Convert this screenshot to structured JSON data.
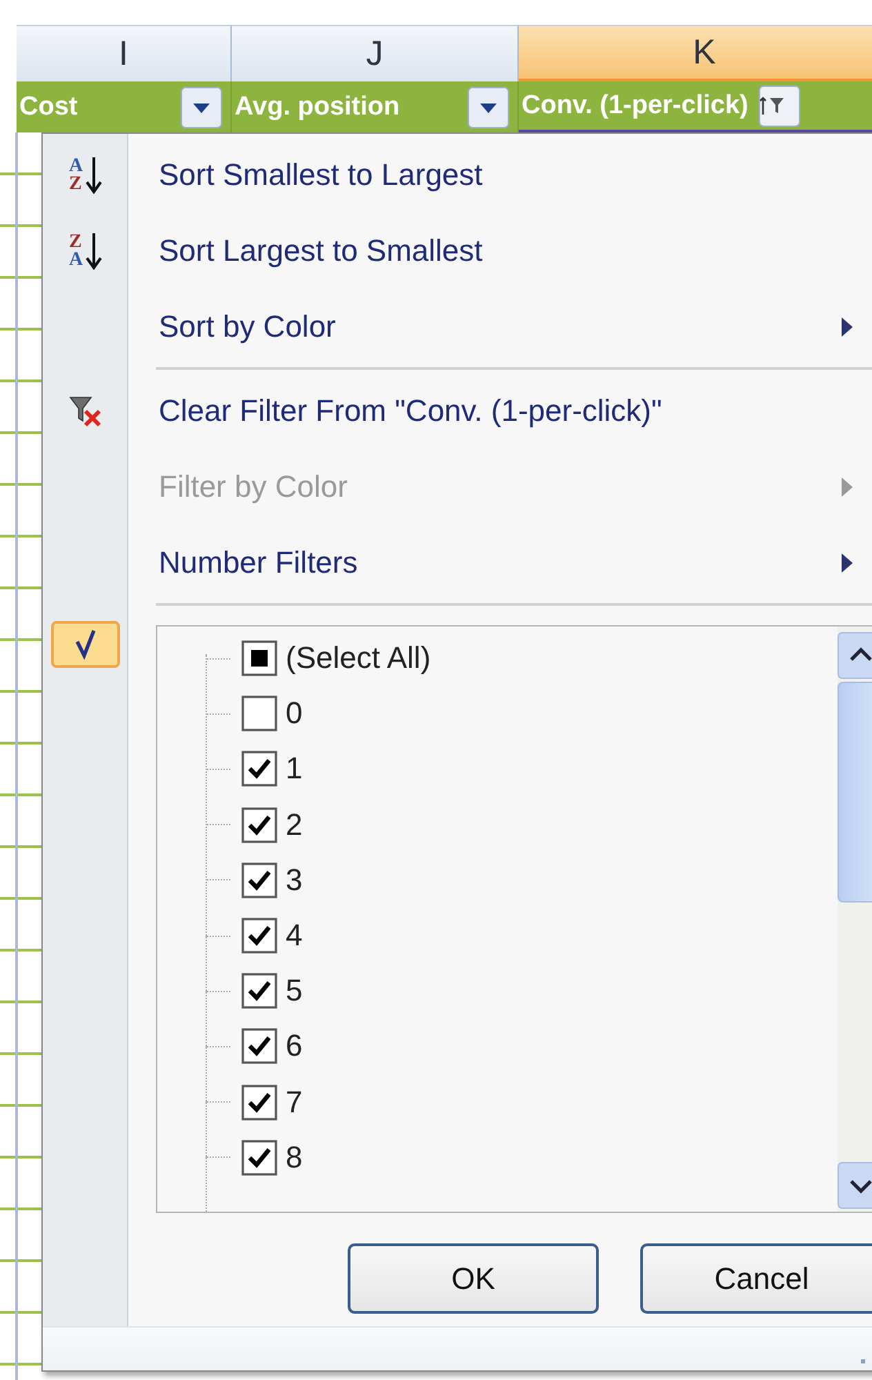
{
  "columns": [
    {
      "letter": "I",
      "selected": false
    },
    {
      "letter": "J",
      "selected": false
    },
    {
      "letter": "K",
      "selected": true
    }
  ],
  "header_cells": [
    {
      "label": "Cost",
      "kind": "dropdown"
    },
    {
      "label": "Avg. position",
      "kind": "dropdown"
    },
    {
      "label": "Conv. (1-per-click)",
      "kind": "filtered"
    }
  ],
  "menu_items": [
    {
      "kind": "sort_ascending",
      "label": "Sort Smallest to Largest",
      "icon_text": [
        "A",
        "Z"
      ],
      "disabled": false,
      "submenu": false
    },
    {
      "kind": "sort_descending",
      "label": "Sort Largest to Smallest",
      "icon_text": [
        "Z",
        "A"
      ],
      "disabled": false,
      "submenu": false
    },
    {
      "kind": "plain",
      "label": "Sort by Color",
      "disabled": false,
      "submenu": true
    },
    {
      "kind": "separator"
    },
    {
      "kind": "clear_filter",
      "label": "Clear Filter From \"Conv. (1-per-click)\"",
      "disabled": false,
      "submenu": false
    },
    {
      "kind": "plain",
      "label": "Filter by Color",
      "disabled": true,
      "submenu": true
    },
    {
      "kind": "plain",
      "label": "Number Filters",
      "disabled": false,
      "submenu": true
    },
    {
      "kind": "separator"
    }
  ],
  "filter_values": [
    {
      "label": "(Select All)",
      "checked": false,
      "partial": true
    },
    {
      "label": "0",
      "checked": false
    },
    {
      "label": "1",
      "checked": true
    },
    {
      "label": "2",
      "checked": true
    },
    {
      "label": "3",
      "checked": true
    },
    {
      "label": "4",
      "checked": true
    },
    {
      "label": "5",
      "checked": true
    },
    {
      "label": "6",
      "checked": true
    },
    {
      "label": "7",
      "checked": true
    },
    {
      "label": "8",
      "checked": true
    }
  ],
  "buttons": [
    {
      "label": "OK"
    },
    {
      "label": "Cancel"
    }
  ]
}
